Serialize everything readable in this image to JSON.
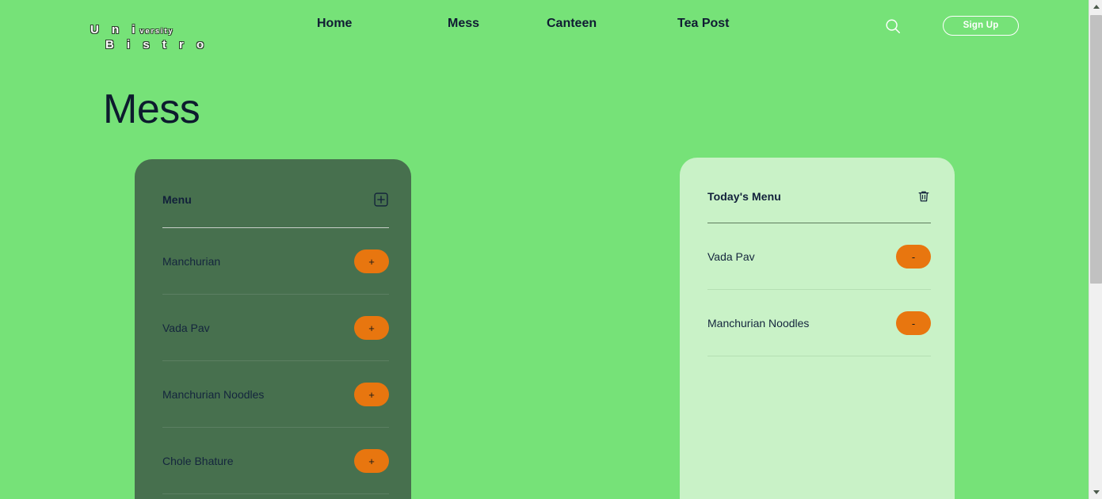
{
  "header": {
    "logo": {
      "uni": "U n i",
      "versity": "versity",
      "bistro": "B i s t r o"
    },
    "nav": [
      {
        "label": "Home"
      },
      {
        "label": "Mess"
      },
      {
        "label": "Canteen"
      },
      {
        "label": "Tea Post"
      }
    ],
    "search_icon": "search-icon",
    "signup_label": "Sign Up"
  },
  "page": {
    "title": "Mess"
  },
  "menu_card": {
    "title": "Menu",
    "action_icon": "add-square-icon",
    "items": [
      {
        "label": "Manchurian",
        "action": "+"
      },
      {
        "label": "Vada Pav",
        "action": "+"
      },
      {
        "label": "Manchurian Noodles",
        "action": "+"
      },
      {
        "label": "Chole Bhature",
        "action": "+"
      }
    ]
  },
  "today_card": {
    "title": "Today's Menu",
    "action_icon": "trash-icon",
    "items": [
      {
        "label": "Vada Pav",
        "action": "-"
      },
      {
        "label": "Manchurian Noodles",
        "action": "-"
      }
    ]
  },
  "colors": {
    "background": "#76e278",
    "menu_card": "#47704e",
    "today_card": "#c9f2c7",
    "accent_orange": "#e8760f",
    "text_dark": "#11203a"
  }
}
